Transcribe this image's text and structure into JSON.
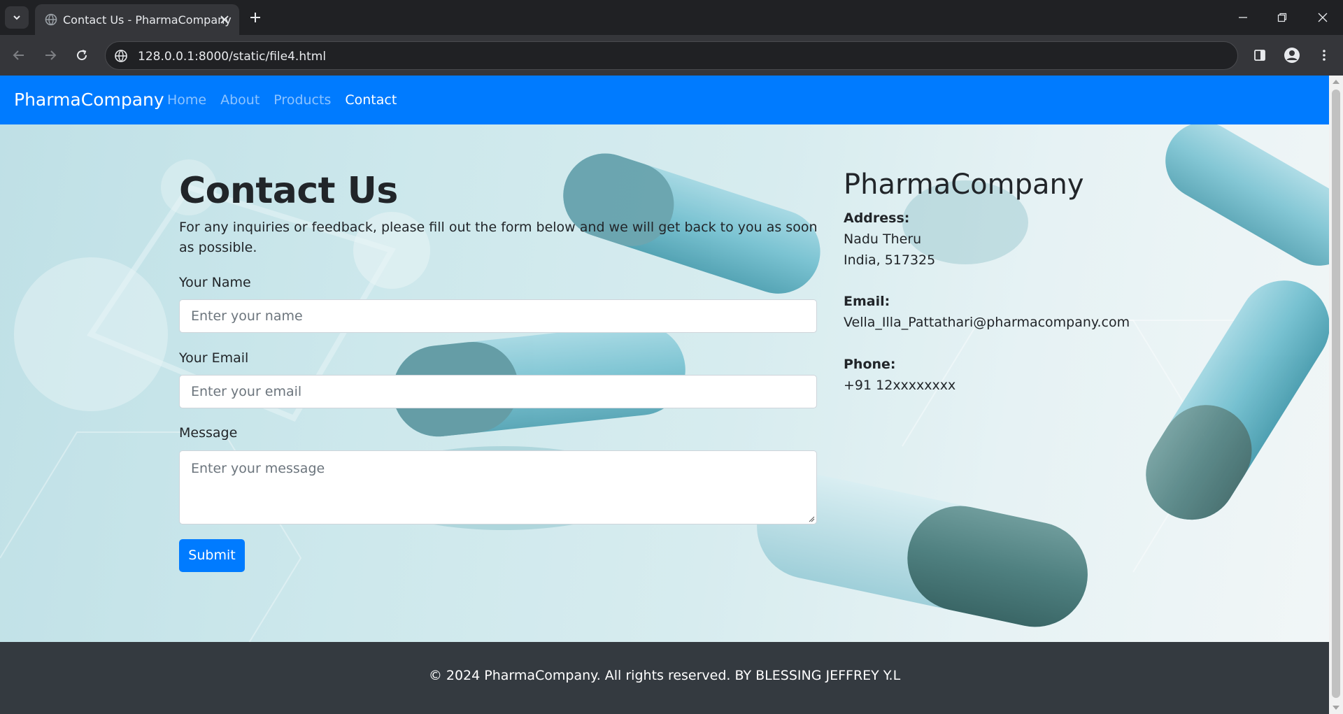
{
  "browser": {
    "tab_title": "Contact Us - PharmaCompany",
    "url": "128.0.0.1:8000/static/file4.html"
  },
  "navbar": {
    "brand": "PharmaCompany",
    "links": [
      {
        "label": "Home",
        "active": false
      },
      {
        "label": "About",
        "active": false
      },
      {
        "label": "Products",
        "active": false
      },
      {
        "label": "Contact",
        "active": true
      }
    ]
  },
  "contact_form": {
    "title": "Contact Us",
    "intro": "For any inquiries or feedback, please fill out the form below and we will get back to you as soon as possible.",
    "name_label": "Your Name",
    "name_placeholder": "Enter your name",
    "email_label": "Your Email",
    "email_placeholder": "Enter your email",
    "message_label": "Message",
    "message_placeholder": "Enter your message",
    "submit_label": "Submit"
  },
  "company_info": {
    "title": "PharmaCompany",
    "address_label": "Address:",
    "address_line1": "Nadu Theru",
    "address_line2": "India, 517325",
    "email_label": "Email:",
    "email_value": "Vella_Illa_Pattathari@pharmacompany.com",
    "phone_label": "Phone:",
    "phone_value": "+91 12xxxxxxxx"
  },
  "footer": {
    "text": "© 2024 PharmaCompany. All rights reserved. BY BLESSING JEFFREY Y.L"
  },
  "colors": {
    "primary": "#007bff",
    "footer_bg": "#343a40",
    "text": "#212529"
  }
}
